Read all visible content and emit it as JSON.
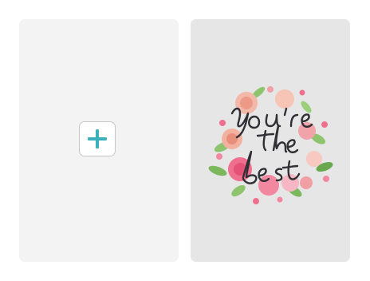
{
  "left_card": {
    "action_icon": "plus-icon",
    "accent_color": "#3ab0bb"
  },
  "right_card": {
    "image": "floral-youre-the-best-card",
    "artwork_text": "you're the best"
  }
}
